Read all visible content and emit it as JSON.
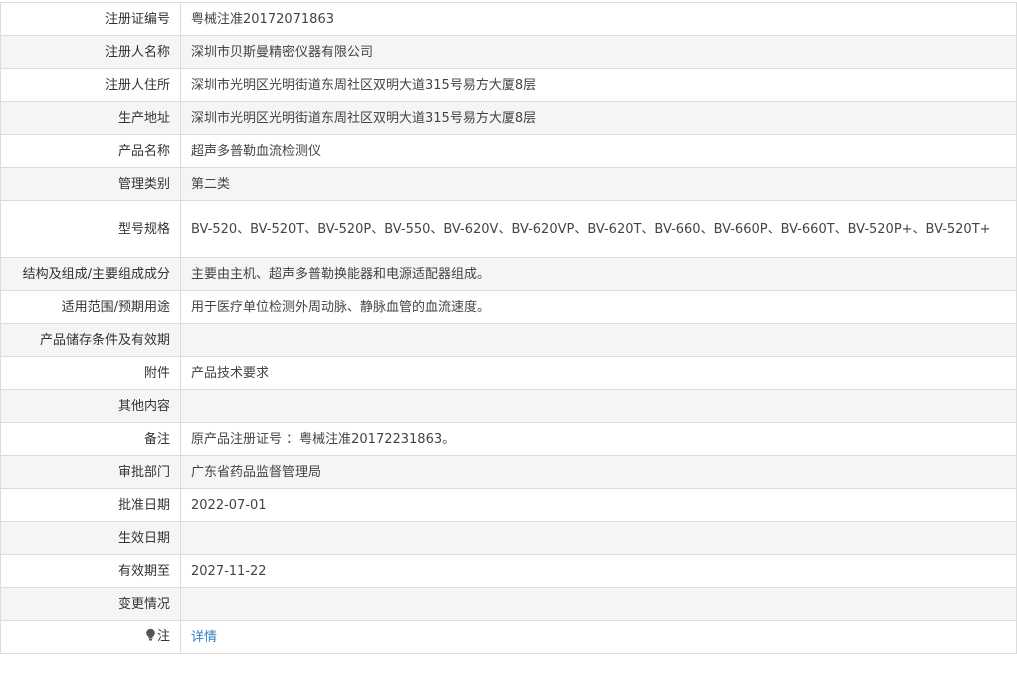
{
  "rows": [
    {
      "label": "注册证编号",
      "value": "粤械注准20172071863"
    },
    {
      "label": "注册人名称",
      "value": "深圳市贝斯曼精密仪器有限公司"
    },
    {
      "label": "注册人住所",
      "value": "深圳市光明区光明街道东周社区双明大道315号易方大厦8层"
    },
    {
      "label": "生产地址",
      "value": "深圳市光明区光明街道东周社区双明大道315号易方大厦8层"
    },
    {
      "label": "产品名称",
      "value": "超声多普勒血流检测仪"
    },
    {
      "label": "管理类别",
      "value": "第二类"
    },
    {
      "label": "型号规格",
      "value": "BV-520、BV-520T、BV-520P、BV-550、BV-620V、BV-620VP、BV-620T、BV-660、BV-660P、BV-660T、BV-520P+、BV-520T+"
    },
    {
      "label": "结构及组成/主要组成成分",
      "value": "主要由主机、超声多普勒换能器和电源适配器组成。"
    },
    {
      "label": "适用范围/预期用途",
      "value": "用于医疗单位检测外周动脉、静脉血管的血流速度。"
    },
    {
      "label": "产品储存条件及有效期",
      "value": ""
    },
    {
      "label": "附件",
      "value": "产品技术要求"
    },
    {
      "label": "其他内容",
      "value": ""
    },
    {
      "label": "备注",
      "value": "原产品注册证号 ：粤械注准20172231863。"
    },
    {
      "label": "审批部门",
      "value": "广东省药品监督管理局"
    },
    {
      "label": "批准日期",
      "value": "2022-07-01"
    },
    {
      "label": "生效日期",
      "value": ""
    },
    {
      "label": "有效期至",
      "value": "2027-11-22"
    },
    {
      "label": "变更情况",
      "value": ""
    }
  ],
  "note_row": {
    "icon": "lightbulb-icon",
    "label": "注",
    "link_text": "详情",
    "link_color": "#2f7fc1"
  }
}
